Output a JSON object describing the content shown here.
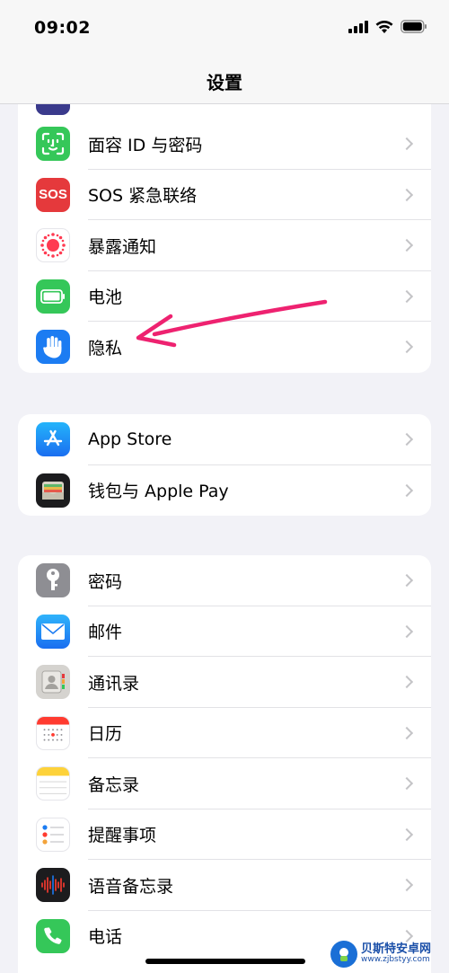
{
  "status_bar": {
    "time": "09:02"
  },
  "nav": {
    "title": "设置"
  },
  "group1": {
    "items": [
      {
        "label": "面容 ID 与密码",
        "icon": "face-id-icon",
        "color": "#35c759"
      },
      {
        "label": "SOS 紧急联络",
        "icon": "sos-icon",
        "color": "#e5393c",
        "icon_text": "SOS"
      },
      {
        "label": "暴露通知",
        "icon": "exposure-icon",
        "color": "#ffffff"
      },
      {
        "label": "电池",
        "icon": "battery-icon",
        "color": "#35c759"
      },
      {
        "label": "隐私",
        "icon": "hand-icon",
        "color": "#1c7cf2"
      }
    ]
  },
  "group2": {
    "items": [
      {
        "label": "App Store",
        "icon": "app-store-icon",
        "color": "#1e8ef5"
      },
      {
        "label": "钱包与 Apple Pay",
        "icon": "wallet-icon",
        "color": "#1c1c1e"
      }
    ]
  },
  "group3": {
    "items": [
      {
        "label": "密码",
        "icon": "key-icon",
        "color": "#8e8e93"
      },
      {
        "label": "邮件",
        "icon": "mail-icon",
        "color": "#1e8ef5"
      },
      {
        "label": "通讯录",
        "icon": "contacts-icon",
        "color": "#d5d3cf"
      },
      {
        "label": "日历",
        "icon": "calendar-icon",
        "color": "#ffffff"
      },
      {
        "label": "备忘录",
        "icon": "notes-icon",
        "color": "#ffffff"
      },
      {
        "label": "提醒事项",
        "icon": "reminders-icon",
        "color": "#ffffff"
      },
      {
        "label": "语音备忘录",
        "icon": "voice-memos-icon",
        "color": "#1c1c1e"
      },
      {
        "label": "电话",
        "icon": "phone-icon",
        "color": "#35c759"
      }
    ]
  },
  "annotation": {
    "arrow_color": "#ee2270"
  },
  "watermark": {
    "name": "贝斯特安卓网",
    "url": "www.zjbstyy.com"
  }
}
